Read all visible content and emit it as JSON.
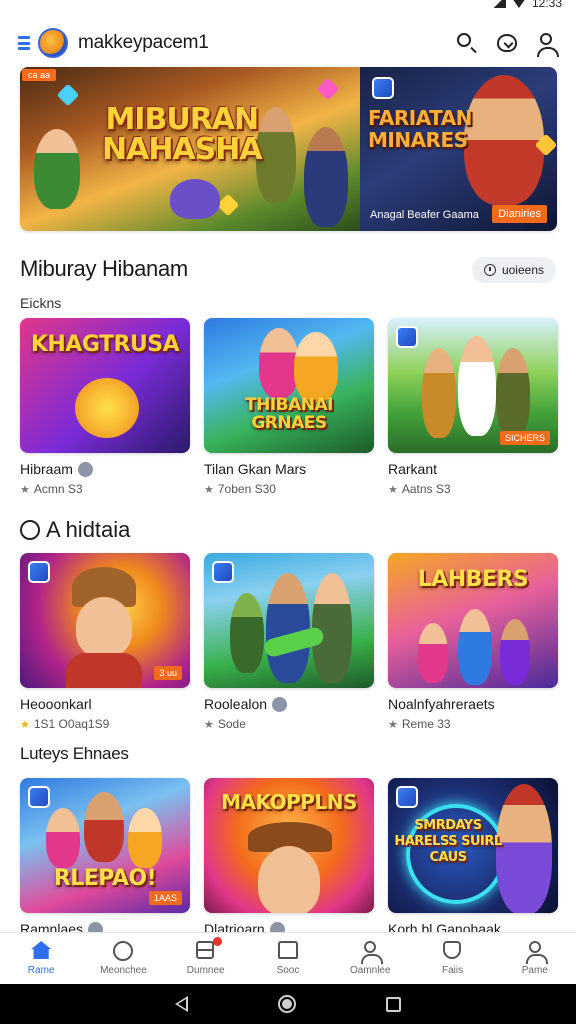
{
  "status_bar": {
    "time": "12:33"
  },
  "header": {
    "title": "makkeypacem1",
    "icons": [
      "menu-icon",
      "app-logo",
      "search-icon",
      "heart-icon",
      "account-icon"
    ]
  },
  "hero": {
    "tag": "ca aa",
    "left_title_line1": "MIBURAN",
    "left_title_line2": "NAHASHA",
    "right_title_line1": "FARIATAN",
    "right_title_line2": "MINARES",
    "subtitle": "Anagal Beafer Gaama",
    "cta": "Dianiries"
  },
  "section1": {
    "title": "Miburay Hibanam",
    "pill_label": "uoieens",
    "subheading": "Eickns",
    "cards": [
      {
        "thumb_title": "KHAGTRUSA",
        "name": "Hibraam",
        "meta": "Acmn S3",
        "colors": [
          "#e2378a",
          "#7a2bd8",
          "#2a1a6a"
        ],
        "tag": ""
      },
      {
        "thumb_title": "THIBANAI GRNAES",
        "name": "Tilan Gkan Mars",
        "meta": "7oben S30",
        "colors": [
          "#2f7ae0",
          "#38b25a",
          "#1c5a2a"
        ],
        "tag": ""
      },
      {
        "thumb_title": "",
        "name": "Rarkant",
        "meta": "Aatns S3",
        "colors": [
          "#8fd15a",
          "#43a33a",
          "#2c6b2a"
        ],
        "tag": "SICHERS"
      }
    ]
  },
  "section2": {
    "title": "A hidtaia",
    "cards": [
      {
        "thumb_title": "",
        "name": "Heooonkarl",
        "meta": "1S1 O0aq1S9",
        "colors": [
          "#f08a1c",
          "#b2238a",
          "#4a1a7a"
        ],
        "tag": "3 uu"
      },
      {
        "thumb_title": "",
        "name": "Roolealon",
        "meta": "Sode",
        "colors": [
          "#3aa9e0",
          "#39b04a",
          "#1f5a2a"
        ],
        "tag": ""
      },
      {
        "thumb_title": "LAHBERS",
        "name": "Noalnfyahreraets",
        "meta": "Reme 33",
        "colors": [
          "#f5a623",
          "#c0308a",
          "#4a2a9a"
        ],
        "tag": ""
      }
    ]
  },
  "section3": {
    "title": "Luteys Ehnaes",
    "cards": [
      {
        "thumb_title": "RLEPAO!",
        "name": "Ramnlaes",
        "colors": [
          "#2f7ae0",
          "#e04a9a",
          "#5a2aa8"
        ],
        "tag": "1AAS"
      },
      {
        "thumb_title": "MAKOPPLNS",
        "name": "Dlatrioarn",
        "colors": [
          "#f26a1b",
          "#e2378a",
          "#7a1a4a"
        ],
        "tag": ""
      },
      {
        "thumb_title": "SMRDAYS HARELSS SUIRL CAUS",
        "name": "Korh bl Ganohaak",
        "colors": [
          "#1a2a6a",
          "#2a5ac0",
          "#0a1030"
        ],
        "tag": ""
      }
    ]
  },
  "bottom_nav": [
    {
      "label": "Rame",
      "icon": "home-icon",
      "active": true
    },
    {
      "label": "Meonchee",
      "icon": "circle-icon",
      "active": false
    },
    {
      "label": "Dumnee",
      "icon": "grid-icon",
      "active": false
    },
    {
      "label": "Sooc",
      "icon": "home-outline-icon",
      "active": false
    },
    {
      "label": "Oamnlee",
      "icon": "person-icon",
      "active": false
    },
    {
      "label": "Faiis",
      "icon": "shield-icon",
      "active": false
    },
    {
      "label": "Pame",
      "icon": "account-icon",
      "active": false
    }
  ],
  "colors": {
    "accent": "#2d6ff0",
    "cta_orange": "#f26a1b"
  }
}
